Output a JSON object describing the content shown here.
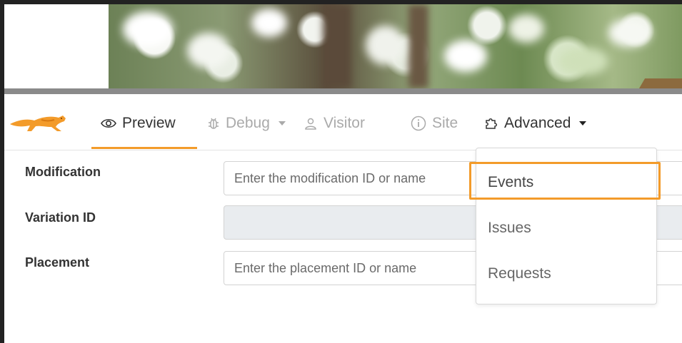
{
  "navbar": {
    "items": [
      {
        "label": "Preview",
        "icon": "eye-icon",
        "active": true
      },
      {
        "label": "Debug",
        "icon": "bug-icon",
        "has_dropdown": true
      },
      {
        "label": "Visitor",
        "icon": "user-icon"
      },
      {
        "label": "Site",
        "icon": "info-icon"
      },
      {
        "label": "Advanced",
        "icon": "puzzle-icon",
        "has_dropdown": true
      }
    ],
    "active_color": "#f39b2a"
  },
  "form": {
    "modification": {
      "label": "Modification",
      "placeholder": "Enter the modification ID or name"
    },
    "variation": {
      "label": "Variation ID",
      "value": ""
    },
    "placement": {
      "label": "Placement",
      "placeholder": "Enter the placement ID or name"
    }
  },
  "advanced_menu": {
    "items": [
      "Events",
      "Issues",
      "Requests"
    ],
    "highlighted": "Events",
    "highlight_color": "#f39b2a"
  }
}
